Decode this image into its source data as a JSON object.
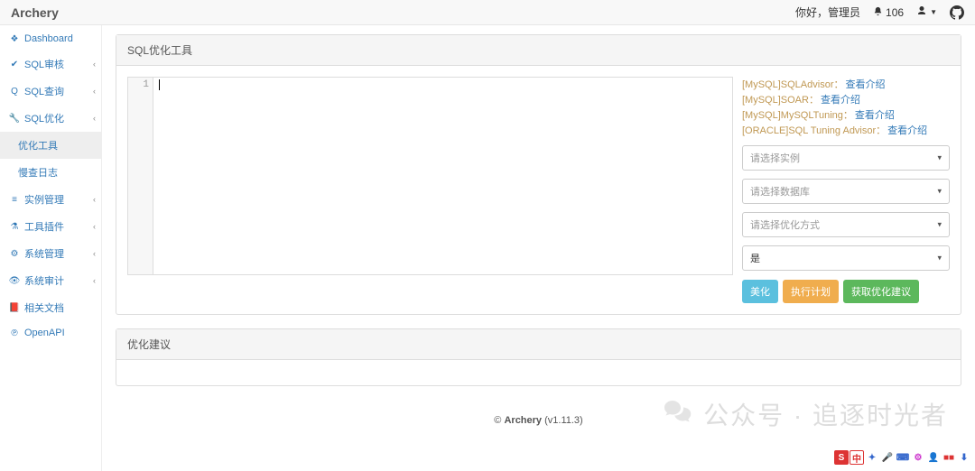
{
  "navbar": {
    "brand": "Archery",
    "greeting": "你好，管理员",
    "notif_count": "106"
  },
  "sidebar": {
    "items": [
      {
        "icon": "dashboard",
        "label": "Dashboard",
        "chev": false
      },
      {
        "icon": "check",
        "label": "SQL审核",
        "chev": true
      },
      {
        "icon": "search",
        "label": "SQL查询",
        "chev": true
      },
      {
        "icon": "wrench",
        "label": "SQL优化",
        "chev": true,
        "children": [
          {
            "label": "优化工具",
            "active": true
          },
          {
            "label": "慢查日志",
            "active": false
          }
        ]
      },
      {
        "icon": "bars",
        "label": "实例管理",
        "chev": true
      },
      {
        "icon": "flask",
        "label": "工具插件",
        "chev": true
      },
      {
        "icon": "cogs",
        "label": "系统管理",
        "chev": true
      },
      {
        "icon": "eye",
        "label": "系统审计",
        "chev": true
      },
      {
        "icon": "book",
        "label": "相关文档",
        "chev": false
      },
      {
        "icon": "api",
        "label": "OpenAPI",
        "chev": false
      }
    ]
  },
  "main": {
    "panel_title": "SQL优化工具",
    "editor": {
      "line_no": "1"
    },
    "refs": [
      {
        "tag": "[MySQL]SQLAdvisor：",
        "link": "查看介绍"
      },
      {
        "tag": "[MySQL]SOAR：",
        "link": "查看介绍"
      },
      {
        "tag": "[MySQL]MySQLTuning：",
        "link": "查看介绍"
      },
      {
        "tag": "[ORACLE]SQL Tuning Advisor：",
        "link": "查看介绍"
      }
    ],
    "selects": {
      "instance": "请选择实例",
      "database": "请选择数据库",
      "method": "请选择优化方式",
      "option": "是"
    },
    "buttons": {
      "beautify": "美化",
      "explain": "执行计划",
      "advice": "获取优化建议"
    },
    "suggest_title": "优化建议"
  },
  "footer": {
    "copy": "© ",
    "name": "Archery",
    "ver": " (v1.11.3)"
  },
  "watermark": "公众号 · 追逐时光者",
  "icon_map": {
    "dashboard": "❖",
    "check": "✔",
    "search": "Q",
    "wrench": "🔧",
    "bars": "≡",
    "flask": "⚗",
    "cogs": "⚙",
    "eye": "👁",
    "book": "📕",
    "api": "℗"
  }
}
